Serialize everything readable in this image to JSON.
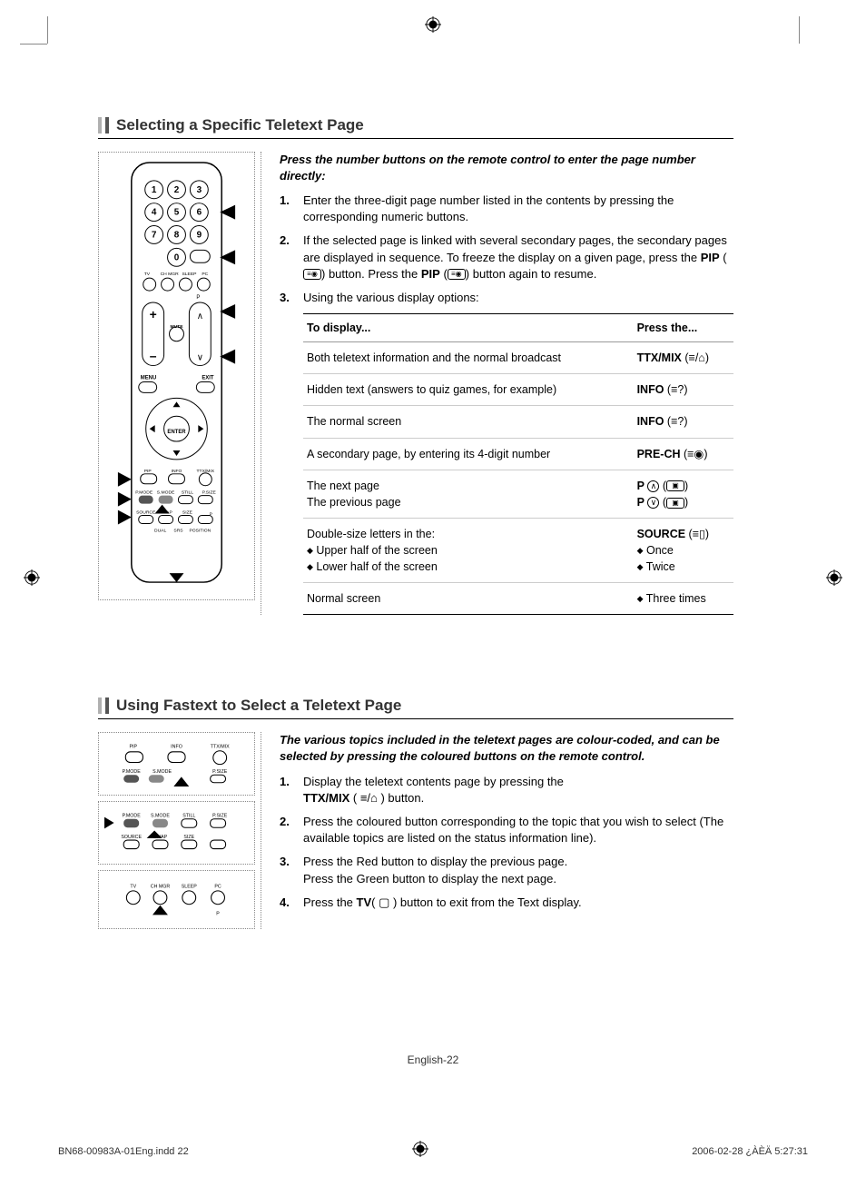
{
  "section1": {
    "title": "Selecting a Specific Teletext Page",
    "intro": "Press the number buttons on the remote control to enter the page number directly:",
    "steps": [
      {
        "num": "1.",
        "text": "Enter the three-digit page number listed in the contents by pressing the corresponding numeric buttons."
      },
      {
        "num": "2.",
        "text_before": "If the selected page is linked with several secondary pages, the secondary pages are displayed in sequence. To freeze the display on a given page, press the ",
        "bold1": "PIP",
        "mid": " button. Press the ",
        "bold2": "PIP",
        "text_after": " button again to resume."
      },
      {
        "num": "3.",
        "text": "Using the various display options:"
      }
    ],
    "table": {
      "header_left": "To display...",
      "header_right": "Press the...",
      "rows": [
        {
          "left": "Both teletext information and the normal broadcast",
          "right": "TTX/MIX",
          "suffix": " (≡/⌂)"
        },
        {
          "left": "Hidden text (answers to quiz games, for example)",
          "right": "INFO",
          "suffix": " (≡?)"
        },
        {
          "left": "The normal screen",
          "right": "INFO",
          "suffix": " (≡?)"
        },
        {
          "left": "A secondary page, by entering its 4-digit number",
          "right": "PRE-CH",
          "suffix": " (≡◉)"
        },
        {
          "left_multi": [
            "The next page",
            "The previous page"
          ],
          "right_multi": [
            "P ⊙ (▣)",
            "P ⊙ (▣)"
          ],
          "p_up": "∧",
          "p_dn": "∨"
        },
        {
          "left_multi": [
            "Double-size letters in the:",
            "◆ Upper half of the screen",
            "◆ Lower half of the screen"
          ],
          "right_multi_bold": "SOURCE",
          "right_suffix": " (≡▯)",
          "right_extra": [
            "◆ Once",
            "◆ Twice"
          ]
        },
        {
          "left": "Normal screen",
          "right_plain": "◆ Three times"
        }
      ]
    }
  },
  "section2": {
    "title": "Using Fastext to Select a Teletext Page",
    "intro": "The various topics included in the teletext pages are colour-coded, and can be selected by pressing the coloured buttons on the remote control.",
    "steps": [
      {
        "num": "1.",
        "before": "Display the teletext contents page by pressing the ",
        "bold": "TTX/MIX",
        "after": " ( ≡/⌂ ) button."
      },
      {
        "num": "2.",
        "text": "Press the coloured button corresponding to the topic that you wish to select (The available topics are listed on the status information line)."
      },
      {
        "num": "3.",
        "text": "Press the Red button to display the previous page.\nPress the Green button to display the next page."
      },
      {
        "num": "4.",
        "before": "Press the ",
        "bold": "TV",
        "after": "( ▢ ) button to exit from the Text display."
      }
    ]
  },
  "page_number": "English-22",
  "footer_left": "BN68-00983A-01Eng.indd   22",
  "footer_right": "2006-02-28   ¿ÀÈÄ 5:27:31"
}
